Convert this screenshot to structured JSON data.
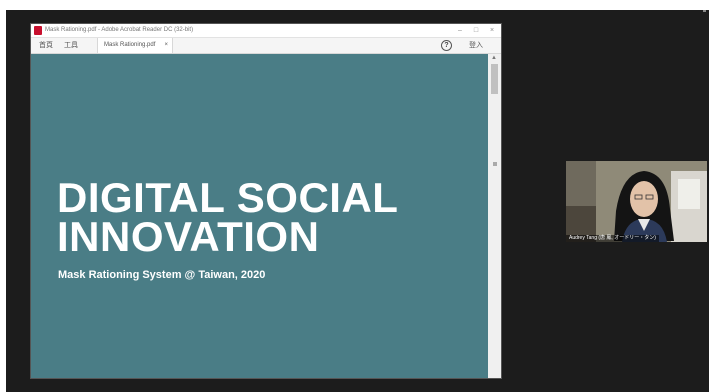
{
  "window": {
    "title": "Mask Rationing.pdf - Adobe Acrobat Reader DC (32-bit)",
    "minimize": "–",
    "maximize": "□",
    "close": "×"
  },
  "menu": {
    "home": "首頁",
    "tools": "工具",
    "tab_label": "Mask Rationing.pdf",
    "tab_close": "×",
    "help": "?",
    "signin": "登入"
  },
  "slide": {
    "title_line1": "DIGITAL SOCIAL",
    "title_line2": "INNOVATION",
    "subtitle": "Mask Rationing System @ Taiwan, 2020",
    "background": "#4a7d86"
  },
  "participant": {
    "name": "Audrey Tang (唐 鳳, オードリー・タン)"
  },
  "icons": [
    "acrobat-icon",
    "help-icon",
    "scroll-up-icon"
  ]
}
